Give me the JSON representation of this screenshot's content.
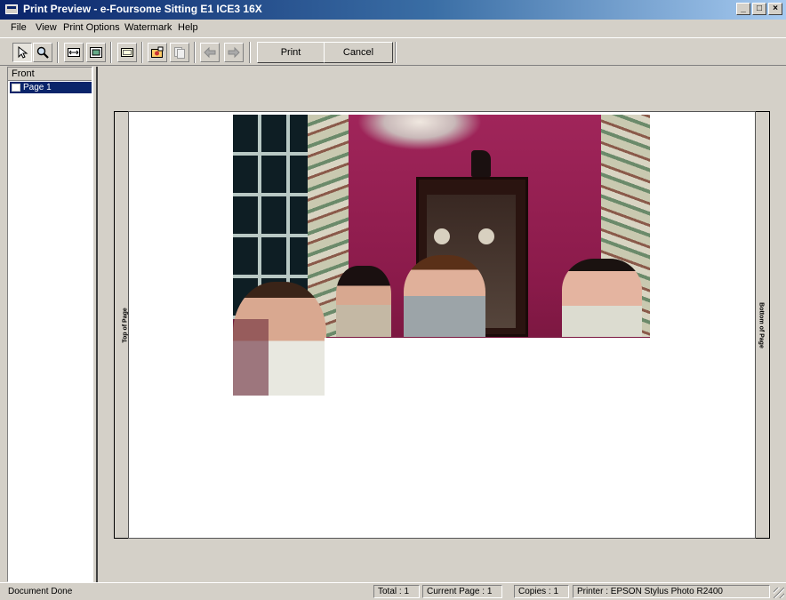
{
  "window": {
    "title": "Print Preview - e-Foursome Sitting E1 ICE3 16X",
    "min_glyph": "_",
    "max_glyph": "□",
    "close_glyph": "×"
  },
  "menu": {
    "file": "File",
    "view": "View",
    "print_options": "Print Options",
    "watermark": "Watermark",
    "help": "Help"
  },
  "toolbar": {
    "print_label": "Print",
    "cancel_label": "Cancel",
    "icons": [
      "pointer-icon",
      "zoom-icon",
      "fit-width-icon",
      "fit-page-icon",
      "page-setup-icon",
      "open-image-icon",
      "copy-icon",
      "back-arrow-icon",
      "forward-arrow-icon"
    ]
  },
  "sidebar": {
    "header": "Front",
    "items": [
      {
        "label": "Page 1"
      }
    ]
  },
  "preview": {
    "top_label": "Top of Page",
    "bottom_label": "Bottom of Page"
  },
  "status": {
    "message": "Document Done",
    "total": "Total : 1",
    "current_page": "Current Page : 1",
    "copies": "Copies : 1",
    "printer": "Printer : EPSON Stylus Photo R2400"
  },
  "colors": {
    "title_start": "#0a246a",
    "title_end": "#a6caf0",
    "wall": "#8a1a4a",
    "chrome": "#d4d0c8"
  }
}
